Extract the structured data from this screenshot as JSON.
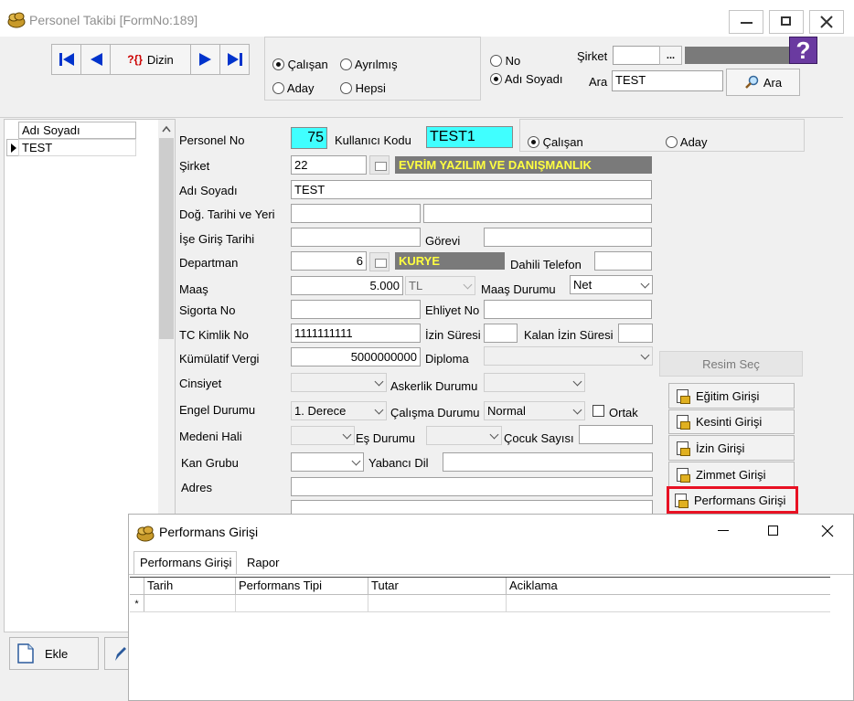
{
  "window": {
    "title": "Personel Takibi [FormNo:189]"
  },
  "toolbar": {
    "nav": {
      "index_label": "Dizin"
    },
    "status_filter": {
      "options": [
        {
          "label": "Çalışan",
          "checked": true
        },
        {
          "label": "Ayrılmış",
          "checked": false
        },
        {
          "label": "Aday",
          "checked": false
        },
        {
          "label": "Hepsi",
          "checked": false
        }
      ]
    },
    "search_mode": {
      "options": [
        {
          "label": "No",
          "checked": false
        },
        {
          "label": "Adı Soyadı",
          "checked": true
        }
      ]
    },
    "sirket": {
      "label": "Şirket",
      "value": "",
      "button": "..."
    },
    "ara": {
      "label": "Ara",
      "value": "TEST",
      "button": "Ara"
    }
  },
  "list": {
    "header": "Adı Soyadı",
    "rows": [
      "TEST"
    ]
  },
  "form": {
    "personel_no": {
      "label": "Personel No",
      "value": "75"
    },
    "kullanici_kodu": {
      "label": "Kullanıcı Kodu",
      "value": "TEST1"
    },
    "type": {
      "options": [
        {
          "label": "Çalışan",
          "checked": true
        },
        {
          "label": "Aday",
          "checked": false
        }
      ]
    },
    "sirket": {
      "label": "Şirket",
      "code": "22",
      "name": "EVRİM YAZILIM VE DANIŞMANLIK"
    },
    "adi_soyadi": {
      "label": "Adı Soyadı",
      "value": "TEST"
    },
    "dogum": {
      "label": "Doğ. Tarihi ve Yeri",
      "date": "",
      "place": ""
    },
    "ise_giris": {
      "label": "İşe Giriş Tarihi",
      "value": ""
    },
    "gorevi": {
      "label": "Görevi",
      "value": ""
    },
    "departman": {
      "label": "Departman",
      "code": "6",
      "name": "KURYE"
    },
    "dahili_telefon": {
      "label": "Dahili Telefon",
      "value": ""
    },
    "maas": {
      "label": "Maaş",
      "value": "5.000",
      "currency": "TL"
    },
    "maas_durumu": {
      "label": "Maaş Durumu",
      "value": "Net"
    },
    "sigorta_no": {
      "label": "Sigorta No",
      "value": ""
    },
    "ehliyet_no": {
      "label": "Ehliyet No",
      "value": ""
    },
    "tc_kimlik": {
      "label": "TC Kimlik No",
      "value": "1111111111"
    },
    "izin_suresi": {
      "label": "İzin Süresi",
      "value": ""
    },
    "kalan_izin": {
      "label": "Kalan İzin Süresi",
      "value": ""
    },
    "kumulatif": {
      "label": "Kümülatif Vergi",
      "value": "5000000000"
    },
    "diploma": {
      "label": "Diploma",
      "value": ""
    },
    "cinsiyet": {
      "label": "Cinsiyet",
      "value": ""
    },
    "askerlik": {
      "label": "Askerlik Durumu",
      "value": ""
    },
    "engel": {
      "label": "Engel Durumu",
      "value": "1. Derece"
    },
    "calisma": {
      "label": "Çalışma Durumu",
      "value": "Normal"
    },
    "ortak": {
      "label": "Ortak",
      "checked": false
    },
    "medeni": {
      "label": "Medeni Hali",
      "value": ""
    },
    "es_durumu": {
      "label": "Eş Durumu",
      "value": ""
    },
    "cocuk": {
      "label": "Çocuk Sayısı",
      "value": ""
    },
    "kan": {
      "label": "Kan Grubu",
      "value": ""
    },
    "yabanci_dil": {
      "label": "Yabancı Dil",
      "value": ""
    },
    "adres": {
      "label": "Adres",
      "value": ""
    }
  },
  "side_buttons": {
    "resim": "Resim Seç",
    "egitim": "Eğitim Girişi",
    "kesinti": "Kesinti Girişi",
    "izin": "İzin Girişi",
    "zimmet": "Zimmet Girişi",
    "performans": "Performans Girişi"
  },
  "bottom": {
    "ekle": "Ekle"
  },
  "popup": {
    "title": "Performans Girişi",
    "tabs": [
      {
        "label": "Performans Girişi",
        "active": true
      },
      {
        "label": "Rapor",
        "active": false
      }
    ],
    "columns": [
      "Tarih",
      "Performans Tipi",
      "Tutar",
      "Aciklama"
    ],
    "new_row_marker": "*"
  },
  "colors": {
    "highlight_cyan": "#40ffff",
    "band_gray": "#7a7a7a",
    "band_text_yellow": "#ffff40",
    "focus_red": "#e81123",
    "nav_blue": "#0033cc"
  }
}
